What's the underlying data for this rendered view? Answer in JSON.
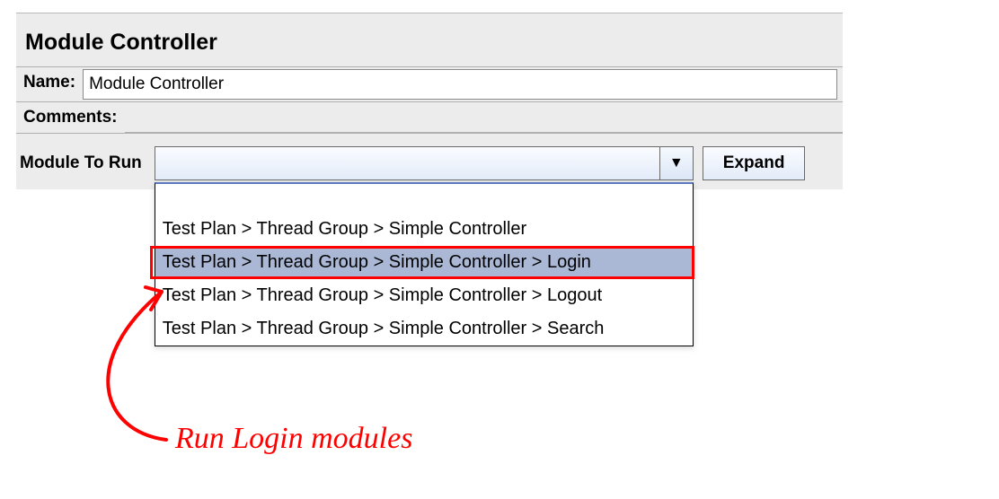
{
  "title": "Module Controller",
  "fields": {
    "name_label": "Name:",
    "name_value": "Module Controller",
    "comments_label": "Comments:",
    "comments_value": ""
  },
  "module_to_run": {
    "label": "Module To Run",
    "selected": "",
    "options": [
      "Test Plan > Thread Group > Simple Controller",
      "Test Plan > Thread Group > Simple Controller > Login",
      "Test Plan > Thread Group > Simple Controller > Logout",
      "Test Plan > Thread Group > Simple Controller > Search"
    ],
    "highlighted_index": 1
  },
  "buttons": {
    "expand": "Expand"
  },
  "annotation": "Run Login modules"
}
